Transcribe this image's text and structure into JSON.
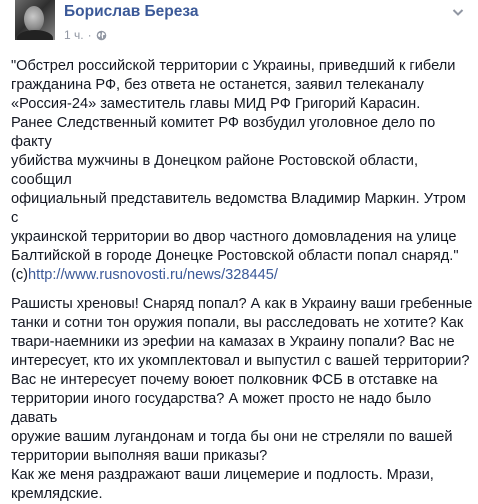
{
  "post": {
    "author": "Борислав Береза",
    "time": "1 ч.",
    "separator": "·",
    "icons": {
      "privacy": "globe-icon",
      "menu": "chevron-down-icon"
    },
    "paragraph1_lines": [
      "\"Обстрел российской территории с Украины, приведший к гибели",
      "гражданина РФ, без ответа не останется, заявил телеканалу",
      "«Россия-24» заместитель главы МИД РФ Григорий Карасин.",
      "Ранее Следственный комитет РФ возбудил уголовное дело по факту",
      "убийства мужчины в Донецком районе Ростовской области, сообщил",
      "официальный представитель ведомства Владимир Маркин. Утром с",
      "украинской территории во двор частного домовладения на улице",
      "Балтийской в городе Донецке Ростовской области попал снаряд.\""
    ],
    "source_prefix": "(с)",
    "source_link": "http://www.rusnovosti.ru/news/328445/",
    "paragraph2_lines": [
      "Рашисты хреновы! Снаряд попал? А как в Украину ваши гребенные",
      "танки и сотни тон оружия попали, вы расследовать не хотите? Как",
      "твари-наемники из эрефии на камазах в Украину попали? Вас не",
      "интересует, кто их укомплектовал и выпустил с вашей территории?",
      "Вас не интересует почему воюет полковник ФСБ в отставке на",
      "территории иного государства? А может просто не надо было давать",
      "оружие вашим лугандонам и тогда бы они не стреляли по вашей",
      "территории выполняя ваши приказы?",
      "Как же меня раздражают ваши лицемерие и подлость. Мрази,",
      "кремлядские."
    ]
  }
}
